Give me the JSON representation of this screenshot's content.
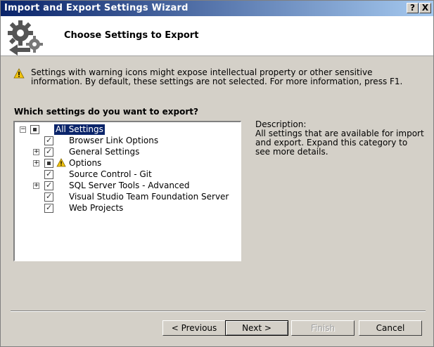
{
  "window": {
    "title": "Import and Export Settings Wizard",
    "help_label": "?",
    "close_label": "X"
  },
  "header": {
    "heading": "Choose Settings to Export"
  },
  "warning": {
    "text": "Settings with warning icons might expose intellectual property or other sensitive information. By default, these settings are not selected. For more information, press F1."
  },
  "question": "Which settings do you want to export?",
  "tree": {
    "root": {
      "label": "All Settings",
      "state": "partial",
      "expander": "−"
    },
    "items": [
      {
        "label": "Browser Link Options",
        "state": "checked",
        "expander": "",
        "warning": false
      },
      {
        "label": "General Settings",
        "state": "checked",
        "expander": "+",
        "warning": false
      },
      {
        "label": "Options",
        "state": "partial",
        "expander": "+",
        "warning": true
      },
      {
        "label": "Source Control - Git",
        "state": "checked",
        "expander": "",
        "warning": false
      },
      {
        "label": "SQL Server Tools - Advanced",
        "state": "checked",
        "expander": "+",
        "warning": false
      },
      {
        "label": "Visual Studio Team Foundation Server",
        "state": "checked",
        "expander": "",
        "warning": false
      },
      {
        "label": "Web Projects",
        "state": "checked",
        "expander": "",
        "warning": false
      }
    ]
  },
  "description": {
    "label": "Description:",
    "text": "All settings that are available for import and export. Expand this category to see more details."
  },
  "buttons": {
    "previous": "< Previous",
    "next": "Next >",
    "finish": "Finish",
    "cancel": "Cancel"
  },
  "colors": {
    "title_bar": "#0a246a",
    "dialog_bg": "#d4d0c8",
    "warning_yellow": "#f2c40f"
  }
}
